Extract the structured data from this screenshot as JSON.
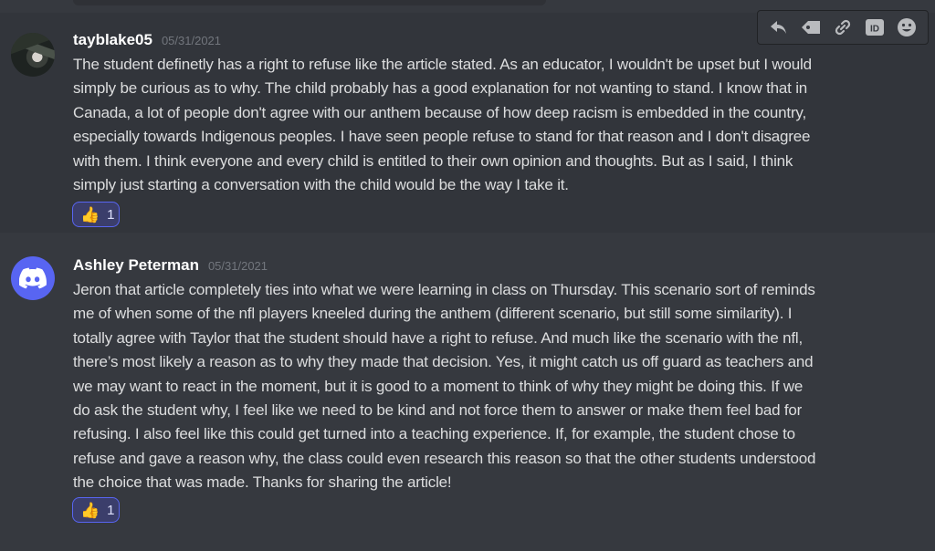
{
  "messages": [
    {
      "username": "tayblake05",
      "timestamp": "05/31/2021",
      "avatar": "user-photo",
      "lines": [
        "The student definetly has a right to refuse like the article stated. As an educator, I wouldn't be upset but I would",
        "simply be curious as to why. The child probably has a good explanation for not wanting to stand. I know that in",
        "Canada, a lot of people don't agree with our anthem because of how deep racism is embedded in the country,",
        "especially towards Indigenous peoples. I have seen people refuse to stand for that reason and I don't disagree",
        "with them. I think everyone and every child is entitled to their own opinion and thoughts. But as I said, I think",
        "simply just starting a conversation with the child would be the way I take it."
      ],
      "reaction": {
        "emoji": "👍",
        "count": "1"
      }
    },
    {
      "username": "Ashley Peterman",
      "timestamp": "05/31/2021",
      "avatar": "discord-logo",
      "lines": [
        "Jeron that article completely ties into what we were learning in class on Thursday. This scenario sort of reminds",
        "me of when some of the nfl players kneeled during the anthem (different scenario, but still some similarity). I",
        "totally agree with Taylor that the student should have a right to refuse. And much like the scenario with the nfl,",
        "there’s most likely a reason as to why they made that decision. Yes, it might catch us off guard as teachers and",
        "we may want to react in the moment, but it is good to a moment to think of why they might be doing this. If we",
        "do ask the student why, I feel like we need to be kind and not force them to answer or make them feel bad for",
        "refusing. I also feel like this could get turned into a teaching experience. If, for example, the student chose to",
        "refuse and gave a reason why, the class could even research this reason so that the other students understood",
        "the choice that was made. Thanks for sharing the article!"
      ],
      "reaction": {
        "emoji": "👍",
        "count": "1"
      }
    }
  ],
  "toolbar": {
    "buttons": [
      "reply-icon",
      "tag-icon",
      "link-icon",
      "id-icon",
      "emoji-icon"
    ]
  },
  "colors": {
    "background": "#36393f",
    "hover_background": "#32353b",
    "text": "#dcddde",
    "username": "#ffffff",
    "timestamp": "#72767d",
    "reaction_border": "#5865f2",
    "reaction_fill": "#3b3e6b",
    "discord_blurple": "#5865f2"
  }
}
